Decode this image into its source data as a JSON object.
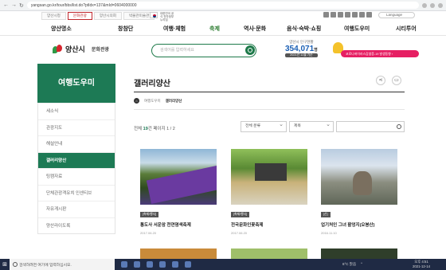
{
  "browser": {
    "url": "yangsan.go.kr/tour/bbs/list.do?ptIdx=137&mId=0604000000"
  },
  "util": {
    "tabs": [
      "양산시청",
      "문화관광",
      "양산시의회",
      "박물관미술관"
    ],
    "active_tab": 1,
    "flag_text": "대한민국 공식 전자정부 누리집",
    "language": "Language"
  },
  "gnb": {
    "items": [
      "양산명소",
      "창참단",
      "여행·체험",
      "축제",
      "역사·문화",
      "음식·숙박·쇼핑",
      "여행도우미",
      "시티투어"
    ]
  },
  "header": {
    "logo_name": "양산시",
    "logo_sub": "문화관광",
    "search_placeholder": "검색어를 입력하세요",
    "pop_label": "양산시 인구현황",
    "pop_value": "354,071",
    "pop_unit": "명",
    "pop_date": "2021년 11월 기준",
    "banner_text": "코로나바이러스감염증-19 발생동향 ›"
  },
  "sidebar": {
    "title": "여행도우미",
    "items": [
      "세소식",
      "관광지도",
      "해설안내",
      "갤러리양산",
      "팅캠자료",
      "단체관광객유치 인센티브",
      "자유게시판",
      "양산라이도록"
    ],
    "active": 3
  },
  "content": {
    "title": "갤러리양산",
    "breadcrumb": [
      "여행도우미",
      "갤러리양산"
    ],
    "count_prefix": "전체",
    "count_value": "19",
    "count_suffix": "건 페이지",
    "page_value": "1 / 2",
    "category_select": "전체 분류",
    "field_select": "제목",
    "cards": [
      {
        "tag": "[축제/행사]",
        "title": "통도사 서운암 천연염색축제",
        "date": "2017.06.20"
      },
      {
        "tag": "[축제/행사]",
        "title": "전국문화인꽃축제",
        "date": "2017.06.20"
      },
      {
        "tag": "[산]",
        "title": "업기처인 그녀 활엉지(오봉산)",
        "date": "2016.11.10"
      }
    ]
  },
  "taskbar": {
    "search_placeholder": "검색하려면 여기에 입력하십시오.",
    "weather": "6°C 맑음",
    "time": "오후 4:51",
    "date": "2021-12-14"
  }
}
